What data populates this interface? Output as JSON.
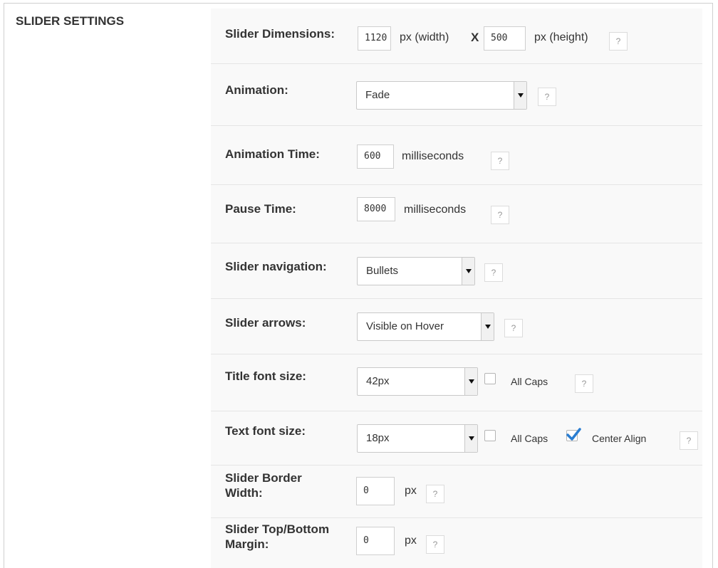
{
  "section_title": "SLIDER SETTINGS",
  "help_label": "?",
  "rows": {
    "dimensions": {
      "label": "Slider Dimensions:",
      "width_value": "1120",
      "width_unit": "px (width)",
      "separator": "X",
      "height_value": "500",
      "height_unit": "px (height)"
    },
    "animation": {
      "label": "Animation:",
      "selected": "Fade"
    },
    "animation_time": {
      "label": "Animation Time:",
      "value": "600",
      "unit": "milliseconds"
    },
    "pause_time": {
      "label": "Pause Time:",
      "value": "8000",
      "unit": "milliseconds"
    },
    "navigation": {
      "label": "Slider navigation:",
      "selected": "Bullets"
    },
    "arrows": {
      "label": "Slider arrows:",
      "selected": "Visible on Hover"
    },
    "title_font": {
      "label": "Title font size:",
      "selected": "42px",
      "all_caps_label": "All Caps",
      "all_caps_checked": false
    },
    "text_font": {
      "label": "Text font size:",
      "selected": "18px",
      "all_caps_label": "All Caps",
      "all_caps_checked": false,
      "center_align_label": "Center Align",
      "center_align_checked": true
    },
    "border_width": {
      "label_line1": "Slider Border",
      "label_line2": "Width:",
      "value": "0",
      "unit": "px"
    },
    "margin": {
      "label_line1": "Slider Top/Bottom",
      "label_line2": "Margin:",
      "value": "0",
      "unit": "px"
    }
  },
  "colors": {
    "panel_bg": "#f9f9f9",
    "check_accent": "#2a7dd1"
  }
}
